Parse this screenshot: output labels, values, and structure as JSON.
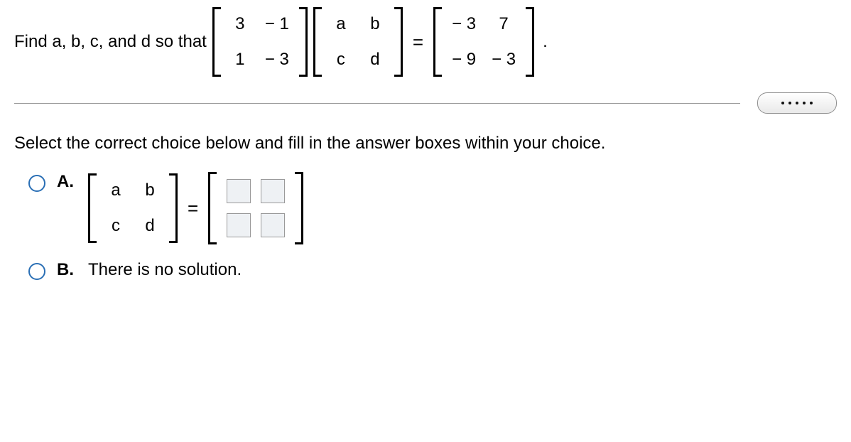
{
  "question": {
    "prompt": "Find a, b, c, and d so that",
    "matrix1": {
      "r1c1": "3",
      "r1c2": "− 1",
      "r2c1": "1",
      "r2c2": "− 3"
    },
    "matrix2": {
      "r1c1": "a",
      "r1c2": "b",
      "r2c1": "c",
      "r2c2": "d"
    },
    "eq": "=",
    "matrix3": {
      "r1c1": "− 3",
      "r1c2": "7",
      "r2c1": "− 9",
      "r2c2": "− 3"
    },
    "period": "."
  },
  "instruction": "Select the correct choice below and fill in the answer boxes within your choice.",
  "choices": {
    "a": {
      "label": "A.",
      "matrix": {
        "r1c1": "a",
        "r1c2": "b",
        "r2c1": "c",
        "r2c2": "d"
      },
      "eq": "="
    },
    "b": {
      "label": "B.",
      "text": "There is no solution."
    }
  }
}
